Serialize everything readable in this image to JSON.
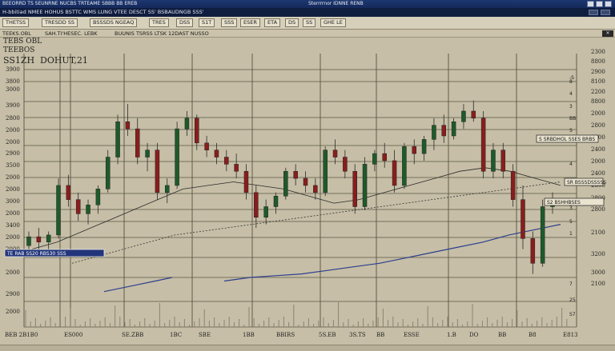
{
  "window": {
    "title_left": "BEEORRD TS SEUNRNE NUCBS TRTEAME SBBB BB EREB",
    "title_center": "Sterrrrnor IDNNE RENB"
  },
  "toolbar": {
    "text": "H-bbitiad NMEE  HOHUS BSTTC  WMS LUNG  VTEE  DESCT  SS' BSBAUDNGB  SSS'"
  },
  "toolbar2": {
    "buttons": [
      "THETSS",
      "TRESDD SS",
      "BSSSDS NGEAQ",
      "TRES",
      "DSS",
      "S1T",
      "SSS",
      "ESER",
      "ETA",
      "DS",
      "SS",
      "GHE LE"
    ]
  },
  "infobar": {
    "i1": "TEEKS.OBL",
    "i2": "SAH.TI'HESEC. LEBK",
    "i3": "BUUNIS TSRSS LTSK 12DAST NUSSO"
  },
  "chart_header": {
    "line1": "TEBS OBL",
    "line2": "TEEBOS",
    "line3": "SS1ZH",
    "line4": "DOHUT,21"
  },
  "chart_data": {
    "type": "candlestick",
    "y_left_ticks": [
      "3900",
      "3800",
      "3000",
      "3900",
      "2800",
      "2000",
      "2000",
      "2900",
      "3500",
      "2000",
      "2000",
      "3000",
      "2000",
      "3400",
      "2000",
      "2000",
      "2000",
      "2900",
      "2000"
    ],
    "y_right_ticks": [
      "2300",
      "8800",
      "2900",
      "8100",
      "2200",
      "8800",
      "2000",
      "2800",
      "2000",
      "2400",
      "2000",
      "2400",
      "2800",
      "2800",
      "2800",
      "2100",
      "3200",
      "3000",
      "2100"
    ],
    "x_ticks": [
      "BEB 2B1B0",
      "ES000",
      "SE.ZBB",
      "1BC",
      "SBE",
      "1BB",
      "BBIRS",
      "5S.EB",
      "3S.TS",
      "BB",
      "ESSE",
      "1.B",
      "DO",
      "BB",
      "B8",
      "E813"
    ],
    "annotations": {
      "box1": "TE RAB SS20 RBS30 SSS",
      "box2": "S SRBDHOL SSES BRBS",
      "box3": "SR BSSSDSSSSS",
      "box4": "S2 BSHHBSES"
    },
    "mid_ticks": [
      "-S",
      "8",
      "4",
      "3",
      "BB",
      "S",
      "4",
      "3",
      "5",
      "1",
      "7",
      "25",
      "S7"
    ],
    "ohlc": [
      [
        2430,
        2470,
        2400,
        2455
      ],
      [
        2455,
        2480,
        2420,
        2440
      ],
      [
        2440,
        2470,
        2410,
        2460
      ],
      [
        2460,
        2620,
        2450,
        2600
      ],
      [
        2600,
        2630,
        2540,
        2560
      ],
      [
        2560,
        2580,
        2500,
        2520
      ],
      [
        2520,
        2560,
        2490,
        2545
      ],
      [
        2545,
        2600,
        2520,
        2590
      ],
      [
        2590,
        2700,
        2580,
        2680
      ],
      [
        2680,
        2800,
        2660,
        2780
      ],
      [
        2780,
        2830,
        2740,
        2760
      ],
      [
        2760,
        2790,
        2660,
        2680
      ],
      [
        2680,
        2720,
        2640,
        2700
      ],
      [
        2700,
        2720,
        2560,
        2580
      ],
      [
        2580,
        2620,
        2550,
        2600
      ],
      [
        2600,
        2780,
        2590,
        2760
      ],
      [
        2760,
        2810,
        2740,
        2790
      ],
      [
        2790,
        2800,
        2700,
        2720
      ],
      [
        2720,
        2740,
        2680,
        2700
      ],
      [
        2700,
        2720,
        2660,
        2680
      ],
      [
        2680,
        2700,
        2640,
        2660
      ],
      [
        2660,
        2690,
        2620,
        2640
      ],
      [
        2640,
        2660,
        2560,
        2580
      ],
      [
        2580,
        2600,
        2480,
        2510
      ],
      [
        2510,
        2560,
        2490,
        2540
      ],
      [
        2540,
        2580,
        2520,
        2570
      ],
      [
        2570,
        2650,
        2560,
        2640
      ],
      [
        2640,
        2660,
        2600,
        2620
      ],
      [
        2620,
        2640,
        2580,
        2600
      ],
      [
        2600,
        2620,
        2560,
        2580
      ],
      [
        2580,
        2710,
        2570,
        2700
      ],
      [
        2700,
        2730,
        2660,
        2680
      ],
      [
        2680,
        2700,
        2620,
        2640
      ],
      [
        2640,
        2660,
        2520,
        2540
      ],
      [
        2540,
        2680,
        2530,
        2660
      ],
      [
        2660,
        2700,
        2640,
        2690
      ],
      [
        2690,
        2720,
        2650,
        2670
      ],
      [
        2670,
        2700,
        2580,
        2600
      ],
      [
        2600,
        2720,
        2590,
        2710
      ],
      [
        2710,
        2730,
        2660,
        2690
      ],
      [
        2690,
        2740,
        2670,
        2730
      ],
      [
        2730,
        2790,
        2700,
        2770
      ],
      [
        2770,
        2800,
        2720,
        2740
      ],
      [
        2740,
        2790,
        2730,
        2780
      ],
      [
        2780,
        2830,
        2760,
        2810
      ],
      [
        2810,
        2840,
        2780,
        2790
      ],
      [
        2790,
        2810,
        2620,
        2640
      ],
      [
        2640,
        2720,
        2620,
        2700
      ],
      [
        2700,
        2720,
        2620,
        2640
      ],
      [
        2640,
        2660,
        2540,
        2560
      ],
      [
        2560,
        2600,
        2420,
        2450
      ],
      [
        2450,
        2470,
        2350,
        2380
      ],
      [
        2380,
        2560,
        2370,
        2540
      ],
      [
        2540,
        2580,
        2520,
        2560
      ]
    ],
    "ma_blue": [
      2300,
      2310,
      2320,
      2330,
      2340,
      2345,
      2350,
      2360,
      2370,
      2380,
      2395,
      2410,
      2425,
      2440,
      2460,
      2475,
      2490
    ],
    "ma_black": [
      2420,
      2440,
      2470,
      2500,
      2530,
      2560,
      2590,
      2600,
      2610,
      2600,
      2590,
      2570,
      2550,
      2560,
      2580,
      2600,
      2620,
      2640,
      2650,
      2640,
      2620,
      2600
    ],
    "ma_dotted": [
      2380,
      2400,
      2420,
      2440,
      2460,
      2470,
      2480,
      2490,
      2500,
      2510,
      2520,
      2530,
      2540,
      2550,
      2560,
      2570,
      2580,
      2590,
      2600,
      2610
    ],
    "ylim": [
      2200,
      2950
    ]
  }
}
